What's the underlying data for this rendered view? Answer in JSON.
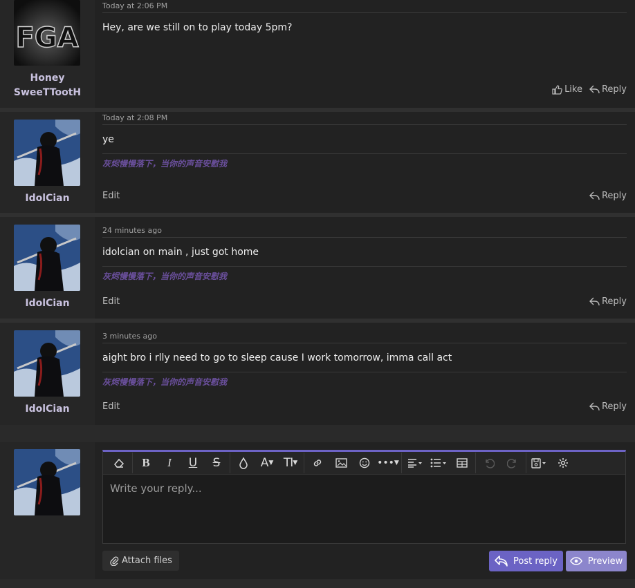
{
  "posts": [
    {
      "username_line1": "Honey",
      "username_line2": "SweeTTootH",
      "timestamp": "Today at 2:06 PM",
      "message": "Hey, are we still on to play today 5pm?",
      "like_label": "Like",
      "reply_label": "Reply",
      "avatar_text": "FGA"
    },
    {
      "username": "IdolCian",
      "timestamp": "Today at 2:08 PM",
      "message": "ye",
      "signature": "灰烬慢慢落下，当你的声音安慰我",
      "edit_label": "Edit",
      "reply_label": "Reply"
    },
    {
      "username": "IdolCian",
      "timestamp": "24 minutes ago",
      "message": "idolcian on main , just got home",
      "signature": "灰烬慢慢落下，当你的声音安慰我",
      "edit_label": "Edit",
      "reply_label": "Reply"
    },
    {
      "username": "IdolCian",
      "timestamp": "3 minutes ago",
      "message": "aight bro i rlly need to go to sleep cause I work tomorrow, imma call act",
      "signature": "灰烬慢慢落下，当你的声音安慰我",
      "edit_label": "Edit",
      "reply_label": "Reply"
    }
  ],
  "reply_box": {
    "placeholder": "Write your reply...",
    "attach_label": "Attach files",
    "post_reply_label": "Post reply",
    "preview_label": "Preview",
    "toolbar": [
      "eraser-icon",
      "bold-icon",
      "italic-icon",
      "underline-icon",
      "strikethrough-icon",
      "color-drop-icon",
      "font-family-icon",
      "font-size-icon",
      "link-icon",
      "image-icon",
      "smiley-icon",
      "more-options-icon",
      "align-icon",
      "list-icon",
      "table-icon",
      "undo-icon",
      "redo-icon",
      "drafts-icon",
      "settings-icon"
    ],
    "toolbar_glyphs": {
      "bold": "B",
      "italic": "I",
      "underline": "U",
      "strike": "S",
      "font": "A",
      "size": "TI"
    }
  },
  "colors": {
    "accent": "#6b63c4",
    "preview": "#8c86cc",
    "username": "#c9c2df",
    "signature": "#6a4f9c",
    "background": "#222222"
  }
}
